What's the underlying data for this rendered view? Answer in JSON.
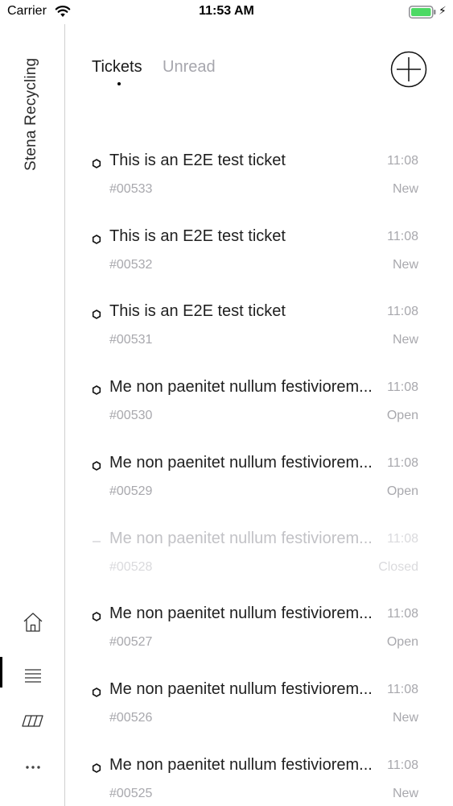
{
  "status_bar": {
    "carrier": "Carrier",
    "time": "11:53 AM"
  },
  "sidebar": {
    "brand": "Stena Recycling",
    "nav": [
      {
        "icon": "home-icon"
      },
      {
        "icon": "list-icon",
        "active": true
      },
      {
        "icon": "containers-icon"
      },
      {
        "icon": "more-icon"
      }
    ]
  },
  "header": {
    "tabs": [
      {
        "label": "Tickets",
        "active": true
      },
      {
        "label": "Unread",
        "active": false
      }
    ],
    "add_icon": "plus-circle-icon"
  },
  "tickets": [
    {
      "title": "This is an E2E test ticket",
      "time": "11:08",
      "number": "#00533",
      "status": "New"
    },
    {
      "title": "This is an E2E test ticket",
      "time": "11:08",
      "number": "#00532",
      "status": "New"
    },
    {
      "title": "This is an E2E test ticket",
      "time": "11:08",
      "number": "#00531",
      "status": "New"
    },
    {
      "title": "Me non paenitet nullum festiviorem...",
      "time": "11:08",
      "number": "#00530",
      "status": "Open"
    },
    {
      "title": "Me non paenitet nullum festiviorem...",
      "time": "11:08",
      "number": "#00529",
      "status": "Open"
    },
    {
      "title": "Me non paenitet nullum festiviorem...",
      "time": "11:08",
      "number": "#00528",
      "status": "Closed"
    },
    {
      "title": "Me non paenitet nullum festiviorem...",
      "time": "11:08",
      "number": "#00527",
      "status": "Open"
    },
    {
      "title": "Me non paenitet nullum festiviorem...",
      "time": "11:08",
      "number": "#00526",
      "status": "New"
    },
    {
      "title": "Me non paenitet nullum festiviorem...",
      "time": "11:08",
      "number": "#00525",
      "status": "New"
    }
  ],
  "colors": {
    "battery": "#4cd964",
    "muted_text": "#a8a8ad",
    "divider": "#cfcfcf"
  }
}
